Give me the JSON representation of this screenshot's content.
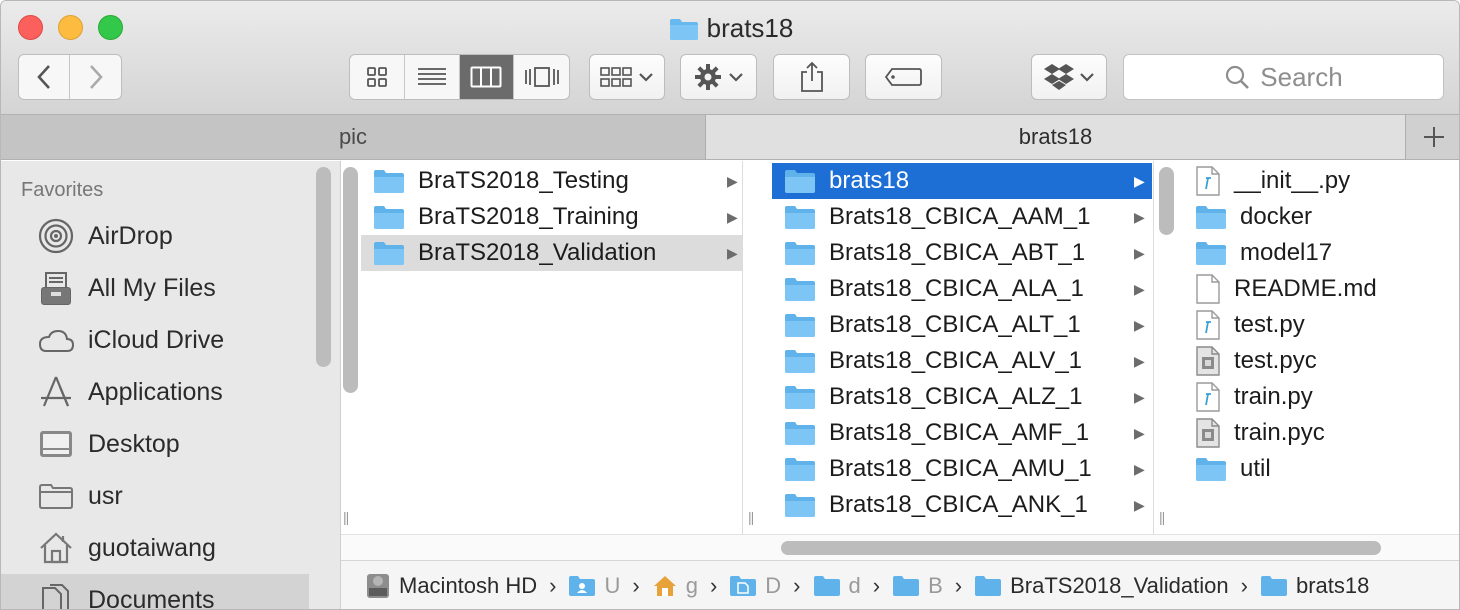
{
  "window": {
    "title": "brats18"
  },
  "toolbar": {
    "search_placeholder": "Search",
    "view_modes": [
      "icon-view",
      "list-view",
      "column-view",
      "cover-flow-view"
    ],
    "active_view": "column-view"
  },
  "tabs": [
    {
      "label": "pic",
      "active": false
    },
    {
      "label": "brats18",
      "active": true
    }
  ],
  "sidebar": {
    "section": "Favorites",
    "items": [
      {
        "label": "AirDrop",
        "icon": "airdrop-icon"
      },
      {
        "label": "All My Files",
        "icon": "all-my-files-icon"
      },
      {
        "label": "iCloud Drive",
        "icon": "cloud-icon"
      },
      {
        "label": "Applications",
        "icon": "applications-icon"
      },
      {
        "label": "Desktop",
        "icon": "desktop-icon"
      },
      {
        "label": "usr",
        "icon": "folder-icon"
      },
      {
        "label": "guotaiwang",
        "icon": "home-icon"
      },
      {
        "label": "Documents",
        "icon": "documents-icon"
      }
    ]
  },
  "columns": {
    "col1": [
      {
        "label": "BraTS2018_Testing",
        "type": "folder"
      },
      {
        "label": "BraTS2018_Training",
        "type": "folder"
      },
      {
        "label": "BraTS2018_Validation",
        "type": "folder",
        "state": "highlighted"
      }
    ],
    "col2": [
      {
        "label": "brats18",
        "type": "folder",
        "state": "selected"
      },
      {
        "label": "Brats18_CBICA_AAM_1",
        "type": "folder"
      },
      {
        "label": "Brats18_CBICA_ABT_1",
        "type": "folder"
      },
      {
        "label": "Brats18_CBICA_ALA_1",
        "type": "folder"
      },
      {
        "label": "Brats18_CBICA_ALT_1",
        "type": "folder"
      },
      {
        "label": "Brats18_CBICA_ALV_1",
        "type": "folder"
      },
      {
        "label": "Brats18_CBICA_ALZ_1",
        "type": "folder"
      },
      {
        "label": "Brats18_CBICA_AMF_1",
        "type": "folder"
      },
      {
        "label": "Brats18_CBICA_AMU_1",
        "type": "folder"
      },
      {
        "label": "Brats18_CBICA_ANK_1",
        "type": "folder"
      }
    ],
    "col3": [
      {
        "label": "__init__.py",
        "type": "python"
      },
      {
        "label": "docker",
        "type": "folder"
      },
      {
        "label": "model17",
        "type": "folder"
      },
      {
        "label": "README.md",
        "type": "document"
      },
      {
        "label": "test.py",
        "type": "python"
      },
      {
        "label": "test.pyc",
        "type": "compiled"
      },
      {
        "label": "train.py",
        "type": "python"
      },
      {
        "label": "train.pyc",
        "type": "compiled"
      },
      {
        "label": "util",
        "type": "folder"
      }
    ]
  },
  "pathbar": [
    {
      "label": "Macintosh HD",
      "icon": "hard-drive-icon",
      "faded": false
    },
    {
      "label": "U",
      "icon": "users-folder-icon",
      "faded": true
    },
    {
      "label": "g",
      "icon": "home-icon",
      "faded": true
    },
    {
      "label": "D",
      "icon": "documents-icon",
      "faded": true
    },
    {
      "label": "d",
      "icon": "folder-icon",
      "faded": true
    },
    {
      "label": "B",
      "icon": "folder-icon",
      "faded": true
    },
    {
      "label": "BraTS2018_Validation",
      "icon": "folder-icon",
      "faded": false
    },
    {
      "label": "brats18",
      "icon": "folder-icon",
      "faded": false
    }
  ],
  "colors": {
    "selection": "#1d6fd6",
    "folder": "#5fb3ea",
    "sidebar_bg": "#e8e8e8"
  }
}
